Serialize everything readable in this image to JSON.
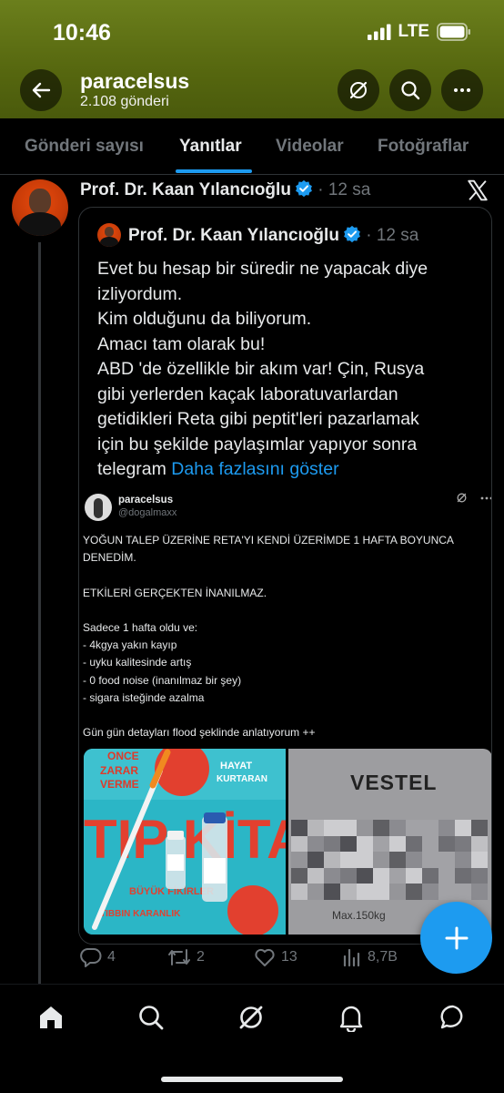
{
  "status_bar": {
    "time": "10:46",
    "network": "LTE"
  },
  "header": {
    "profile_name": "paracelsus",
    "post_count": "2.108 gönderi",
    "colors": {
      "background": "#5a6c12"
    }
  },
  "tabs": [
    {
      "label": "Gönderi sayısı",
      "active": false
    },
    {
      "label": "Yanıtlar",
      "active": true
    },
    {
      "label": "Videolar",
      "active": false
    },
    {
      "label": "Fotoğraflar",
      "active": false
    }
  ],
  "post": {
    "author": "Prof. Dr. Kaan Yılancıoğlu",
    "time": "12 sa",
    "quoted": {
      "author": "Prof. Dr. Kaan Yılancıoğlu",
      "time": "12 sa",
      "lines": [
        "Evet bu hesap bir süredir ne yapacak diye",
        "izliyordum.",
        "Kim olduğunu da biliyorum.",
        "Amacı tam olarak bu!",
        "ABD 'de özellikle bir akım var! Çin, Rusya",
        "gibi yerlerden kaçak laboratuvarlardan",
        "getidikleri Reta gibi peptit'leri pazarlamak",
        "için bu şekilde paylaşımlar yapıyor sonra"
      ],
      "last_line": "telegram",
      "show_more": "Daha fazlasını göster"
    },
    "embedded": {
      "name": "paracelsus",
      "handle": "@dogalmaxx",
      "lines": [
        "YOĞUN TALEP ÜZERİNE RETA'YI KENDİ ÜZERİMDE 1 HAFTA BOYUNCA",
        "DENEDİM.",
        "",
        "ETKİLERİ GERÇEKTEN İNANILMAZ.",
        "",
        "Sadece 1 hafta oldu ve:",
        "- 4kgya yakın kayıp",
        "- uyku kalitesinde artış",
        "- 0 food noise (inanılmaz bir şey)",
        "- sigara isteğinde azalma",
        "",
        "Gün gün detayları flood şeklinde anlatıyorum ++"
      ],
      "image_right_brand": "VESTEL",
      "image_right_label": "Max.150kg"
    },
    "stats": {
      "replies": "4",
      "reposts": "2",
      "likes": "13",
      "views": "8,7B"
    }
  },
  "icons": {
    "back": "back-arrow-icon",
    "grok": "grok-icon",
    "search": "search-icon",
    "more": "more-icon",
    "verified": "verified-badge-icon",
    "x": "x-logo-icon",
    "compose": "plus-icon"
  },
  "colors": {
    "accent": "#1d9bf0",
    "text": "#e7e9ea",
    "muted": "#71767b",
    "background": "#000000"
  }
}
